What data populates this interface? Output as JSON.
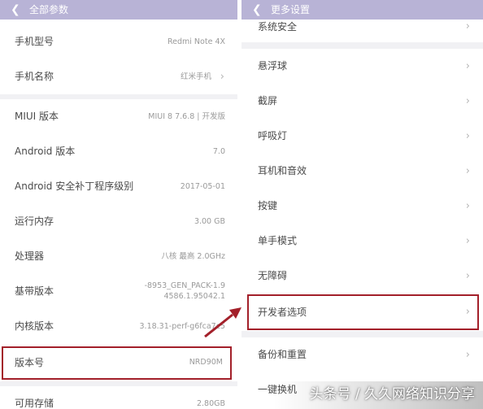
{
  "left": {
    "title": "全部参数",
    "back_icon": "chevron-left-icon",
    "rows": [
      {
        "label": "手机型号",
        "value": "Redmi Note 4X"
      },
      {
        "label": "手机名称",
        "value": "红米手机"
      },
      {
        "label": "MIUI 版本",
        "value": "MIUI 8 7.6.8 | 开发版"
      },
      {
        "label": "Android 版本",
        "value": "7.0"
      },
      {
        "label": "Android 安全补丁程序级别",
        "value": "2017-05-01"
      },
      {
        "label": "运行内存",
        "value": "3.00 GB"
      },
      {
        "label": "处理器",
        "value": "八核 最高 2.0GHz"
      },
      {
        "label": "基带版本",
        "value": "-8953_GEN_PACK-1.9",
        "value2": "4586.1.95042.1"
      },
      {
        "label": "内核版本",
        "value": "3.18.31-perf-g6fca7c5"
      },
      {
        "label": "版本号",
        "value": "NRD90M"
      },
      {
        "label": "可用存储",
        "value": "2.80GB"
      }
    ]
  },
  "right": {
    "title": "更多设置",
    "back_icon": "chevron-left-icon",
    "rows": [
      {
        "label": "系统安全"
      },
      {
        "label": "悬浮球"
      },
      {
        "label": "截屏"
      },
      {
        "label": "呼吸灯"
      },
      {
        "label": "耳机和音效"
      },
      {
        "label": "按键"
      },
      {
        "label": "单手模式"
      },
      {
        "label": "无障碍"
      },
      {
        "label": "开发者选项"
      },
      {
        "label": "备份和重置"
      },
      {
        "label": "一键换机"
      }
    ]
  },
  "watermark": "头条号 / 久久网络知识分享",
  "colors": {
    "header": "#b8b3d6",
    "highlight": "#a3202a",
    "section_gap": "#f1f1f4"
  }
}
